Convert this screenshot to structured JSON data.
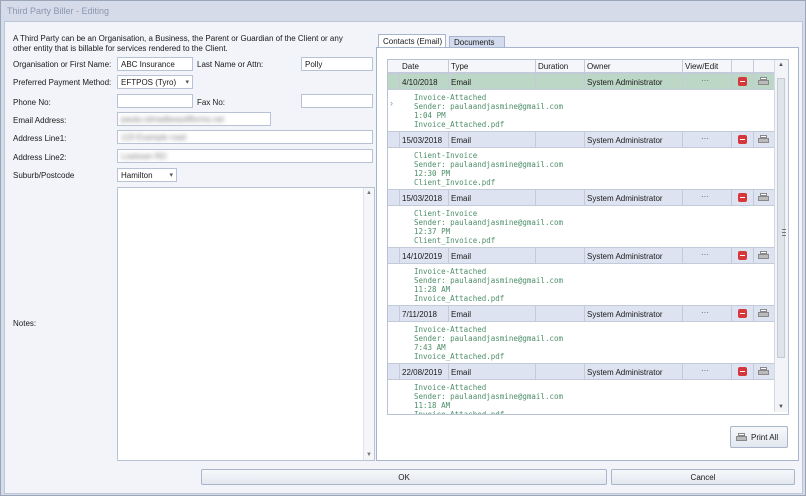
{
  "window": {
    "title": "Third Party Biller - Editing"
  },
  "form": {
    "intro": "A Third Party can be an Organisation, a Business, the Parent or Guardian of the Client or any other entity that is billable for services rendered to the Client.",
    "org_label": "Organisation or First Name:",
    "org_value": "ABC Insurance",
    "last_name_label": "Last Name or Attn:",
    "last_name_value": "Polly",
    "payment_label": "Preferred Payment Method:",
    "payment_value": "EFTPOS (Tyro)",
    "phone_label": "Phone No:",
    "phone_value": "",
    "fax_label": "Fax No:",
    "fax_value": "",
    "email_label": "Email Address:",
    "email_value": "paula.cdmadbeautifforms.net",
    "addr1_label": "Address Line1:",
    "addr1_value": "123 Example road",
    "addr2_label": "Address Line2:",
    "addr2_value": "Lowtown RD",
    "suburb_label": "Suburb/Postcode",
    "suburb_value": "Hamilton",
    "notes_label": "Notes:",
    "notes_value": ""
  },
  "tabs": [
    {
      "label": "Contacts (Email)",
      "active": true
    },
    {
      "label": "Documents",
      "active": false
    }
  ],
  "grid": {
    "columns": [
      "Date",
      "Type",
      "Duration",
      "Owner",
      "View/Edit"
    ],
    "ellipsis": "···",
    "rows": [
      {
        "date": "4/10/2018",
        "type": "Email",
        "duration": "",
        "owner": "System Administrator",
        "selected": true,
        "details": [
          "Invoice-Attached",
          "Sender: paulaandjasmine@gmail.com",
          "1:04 PM",
          "Invoice_Attached.pdf"
        ]
      },
      {
        "date": "15/03/2018",
        "type": "Email",
        "duration": "",
        "owner": "System Administrator",
        "selected": false,
        "details": [
          "Client-Invoice",
          "Sender: paulaandjasmine@gmail.com",
          "12:30 PM",
          "Client_Invoice.pdf"
        ]
      },
      {
        "date": "15/03/2018",
        "type": "Email",
        "duration": "",
        "owner": "System Administrator",
        "selected": false,
        "details": [
          "Client-Invoice",
          "Sender: paulaandjasmine@gmail.com",
          "12:37 PM",
          "Client_Invoice.pdf"
        ]
      },
      {
        "date": "14/10/2019",
        "type": "Email",
        "duration": "",
        "owner": "System Administrator",
        "selected": false,
        "details": [
          "Invoice-Attached",
          "Sender: paulaandjasmine@gmail.com",
          "11:28 AM",
          "Invoice_Attached.pdf"
        ]
      },
      {
        "date": "7/11/2018",
        "type": "Email",
        "duration": "",
        "owner": "System Administrator",
        "selected": false,
        "details": [
          "Invoice-Attached",
          "Sender: paulaandjasmine@gmail.com",
          "7:43 AM",
          "Invoice_Attached.pdf"
        ]
      },
      {
        "date": "22/08/2019",
        "type": "Email",
        "duration": "",
        "owner": "System Administrator",
        "selected": false,
        "details": [
          "Invoice-Attached",
          "Sender: paulaandjasmine@gmail.com",
          "11:18 AM",
          "Invoice_Attached.pdf"
        ]
      }
    ]
  },
  "buttons": {
    "print_all": "Print All",
    "ok": "OK",
    "cancel": "Cancel"
  },
  "icons": {
    "delete": "delete-icon",
    "print": "print-icon",
    "row_pointer": "chevron-right-icon"
  },
  "colors": {
    "selected_row": "#bdd7c6",
    "row_header": "#dde3f0",
    "detail_text": "#4e8f6a",
    "delete_red": "#d6373a"
  }
}
